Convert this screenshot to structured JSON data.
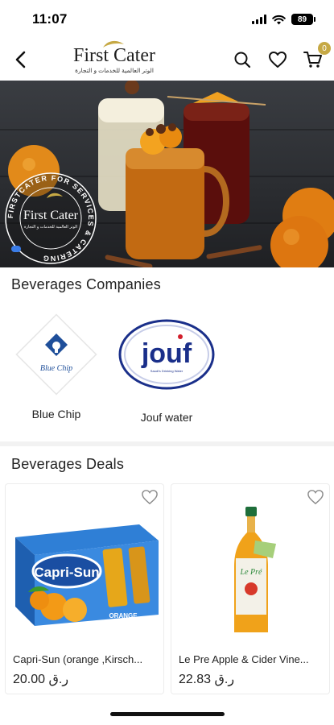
{
  "status": {
    "time": "11:07",
    "battery": "89"
  },
  "header": {
    "logo_title": "First Cater",
    "logo_subtitle": "الوتر العالمية للخدمات و التجارة",
    "cart_count": "0"
  },
  "banner": {
    "badge_title": "First Cater",
    "badge_subtitle": "الوتر العالمية للخدمات و التجارة",
    "badge_ring_text": "FIRSTCATER FOR SERVICES & CATERING"
  },
  "companies": {
    "title": "Beverages Companies",
    "items": [
      {
        "label": "Blue Chip",
        "logo_text": "Blue Chip"
      },
      {
        "label": "Jouf water",
        "logo_text": "jouf",
        "logo_small": "Saudi's Drinking Water"
      }
    ]
  },
  "deals": {
    "title": "Beverages Deals",
    "items": [
      {
        "name": "Capri-Sun (orange ,Kirsch...",
        "price": "20.00 ر.ق",
        "image_text": "Capri-Sun",
        "image_sub": "ORANGE"
      },
      {
        "name": "Le Pre Apple & Cider Vine...",
        "price": "22.83 ر.ق",
        "image_text": "Le Pré"
      }
    ]
  },
  "colors": {
    "accent": "#c6a945",
    "dot": "#3b7de8",
    "bluechip": "#1f4f9a"
  }
}
